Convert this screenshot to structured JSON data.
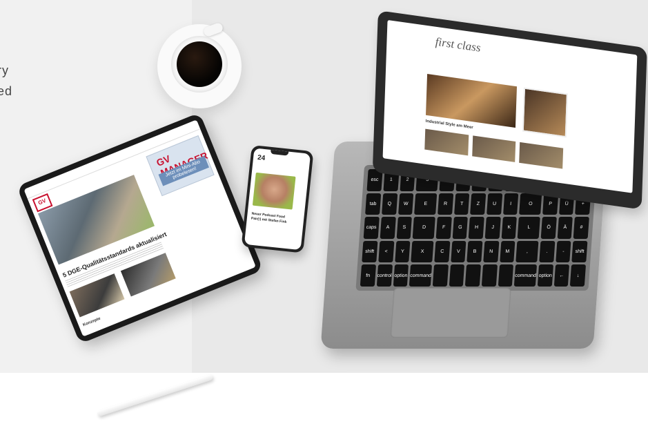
{
  "page": {
    "edge_text_line1": "ry",
    "edge_text_line2": "ed"
  },
  "tablet": {
    "ad_logo": "GV MANAGER",
    "ad_text": "Jetzt im Mini-Abo probelesen!",
    "headline": "5 DGE-Qualitätsstandards aktualisiert",
    "kicker": "Konzepte"
  },
  "phone": {
    "logo": "24",
    "headline": "Neuer Podcast Food Pair(!) mit Stefan Fink"
  },
  "laptop": {
    "screen_logo": "first class",
    "screen_headline": "Industrial Style am Meer"
  },
  "keyboard": {
    "keys": [
      "esc",
      "1",
      "2",
      "3",
      "4",
      "5",
      "6",
      "7",
      "8",
      "9",
      "0",
      "ß",
      "delete",
      "tab",
      "Q",
      "W",
      "E",
      "R",
      "T",
      "Z",
      "U",
      "I",
      "O",
      "P",
      "Ü",
      "+",
      "caps",
      "A",
      "S",
      "D",
      "F",
      "G",
      "H",
      "J",
      "K",
      "L",
      "Ö",
      "Ä",
      "#",
      "shift",
      "<",
      "Y",
      "X",
      "C",
      "V",
      "B",
      "N",
      "M",
      ",",
      ".",
      "-",
      "shift",
      "fn",
      "control",
      "option",
      "command",
      "",
      "",
      "",
      "",
      "",
      "command",
      "option",
      "←",
      "↓"
    ]
  }
}
